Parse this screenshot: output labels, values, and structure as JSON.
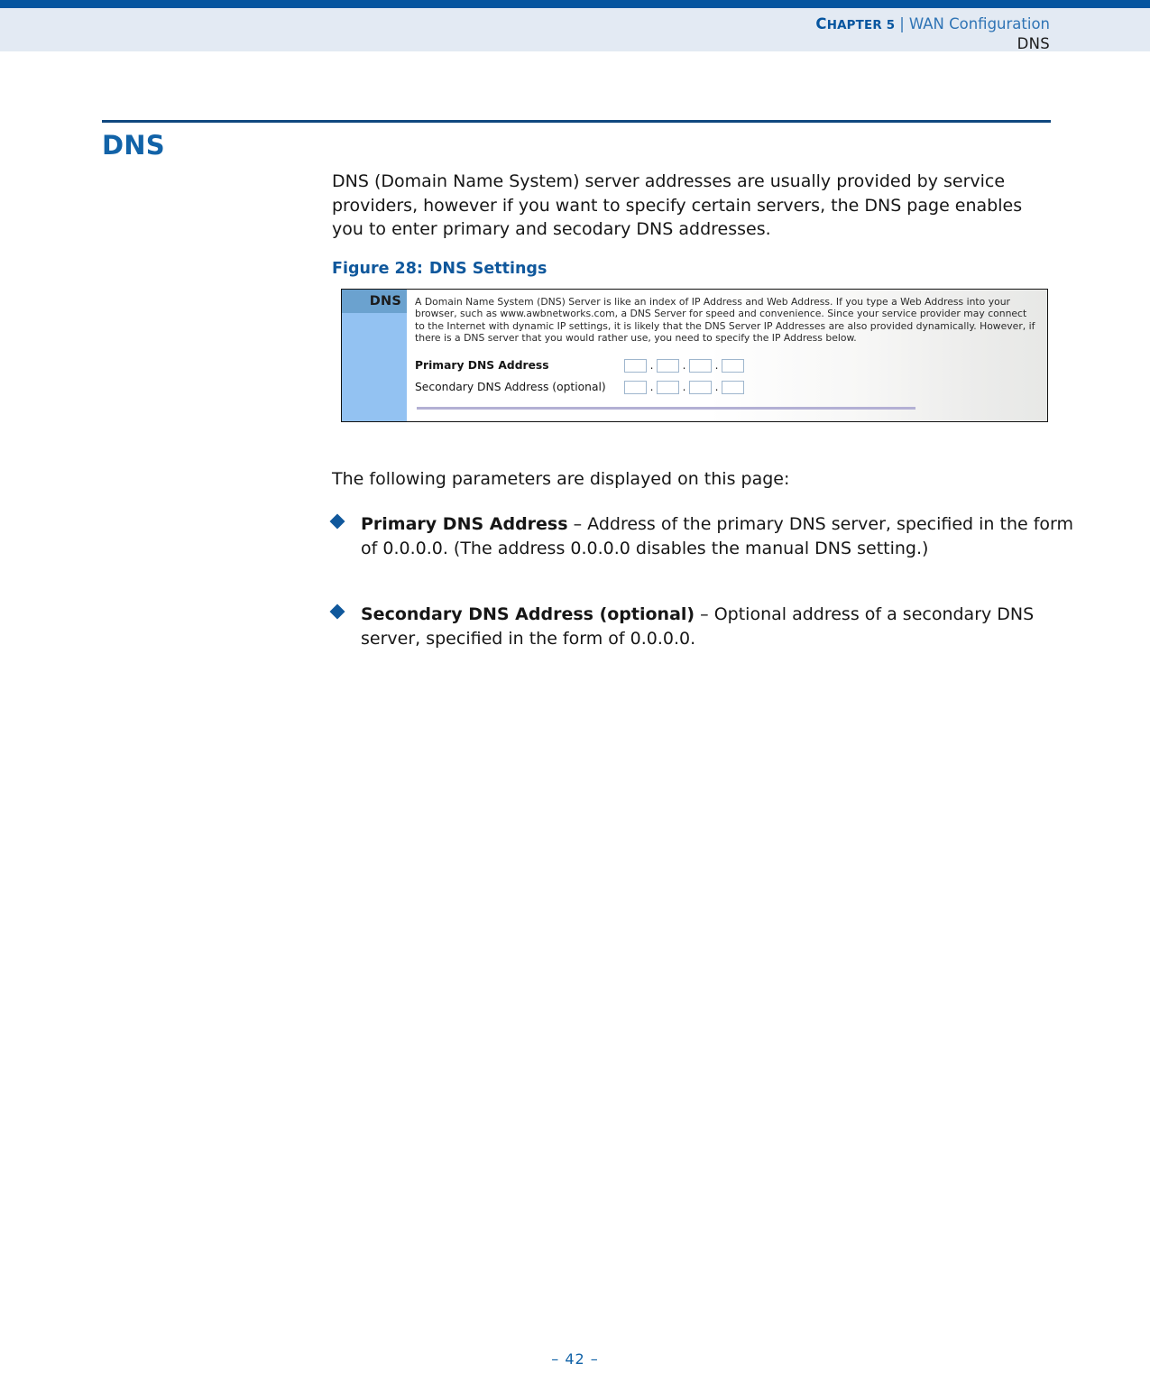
{
  "header": {
    "chapter_label": "Chapter 5",
    "chapter_lead": "C",
    "chapter_rest": "HAPTER 5",
    "separator": "|",
    "chapter_title": "WAN Configuration",
    "section_name": "DNS"
  },
  "section": {
    "title": "DNS",
    "intro": "DNS (Domain Name System) server addresses are usually provided by service providers, however if you want to specify certain servers, the DNS page enables you to enter primary and secodary DNS addresses."
  },
  "figure": {
    "caption_number": "Figure 28:",
    "caption_title": "DNS Settings",
    "sidebar_label": "DNS",
    "description": "A Domain Name System (DNS) Server is like an index of IP Address and Web Address. If you type a Web Address into your browser, such as www.awbnetworks.com, a DNS Server for speed and convenience. Since your service provider may connect to the Internet with dynamic IP settings, it is likely that the DNS Server IP Addresses are also provided dynamically. However, if there is a DNS server that you would rather use, you need to specify the IP Address below.",
    "fields": [
      {
        "label": "Primary DNS Address",
        "bold": true,
        "octets": [
          "",
          "",
          "",
          ""
        ],
        "separator": "."
      },
      {
        "label": "Secondary DNS Address (optional)",
        "bold": false,
        "octets": [
          "",
          "",
          "",
          ""
        ],
        "separator": "."
      }
    ]
  },
  "body": {
    "params_intro": "The following parameters are displayed on this page:",
    "bullets": [
      {
        "term": "Primary DNS Address",
        "dash": " – ",
        "definition": "Address of the primary DNS server, specified in the form of 0.0.0.0. (The address 0.0.0.0 disables the manual DNS setting.)"
      },
      {
        "term": "Secondary DNS Address (optional)",
        "dash": " – ",
        "definition": "Optional address of a secondary DNS server, specified in the form of 0.0.0.0."
      }
    ]
  },
  "footer": {
    "page_number": "–  42  –"
  },
  "colors": {
    "top_rule": "#06559f",
    "header_band": "#e3eaf3",
    "heading_blue": "#1263a8",
    "section_rule": "#10487f",
    "bullet_marker": "#10589c",
    "figure_sidebar": "#93c2f2",
    "figure_sidebar_head": "#6ba2cf",
    "figure_hr": "#b3b0d4",
    "input_border": "#9fb6cd"
  }
}
